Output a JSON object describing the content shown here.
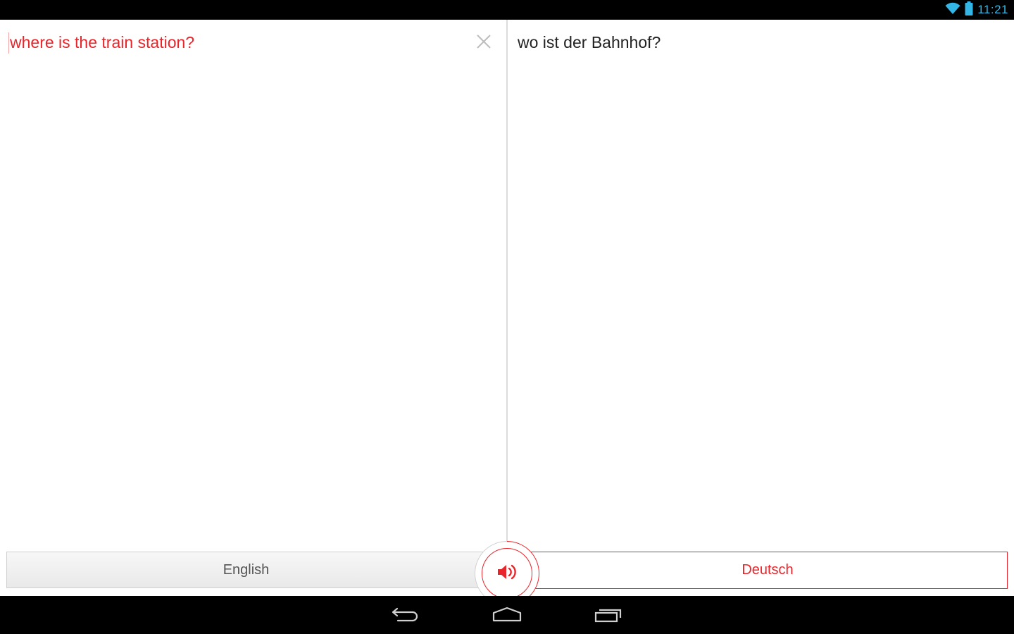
{
  "status_bar": {
    "time": "11:21",
    "icons": [
      "wifi-icon",
      "battery-icon"
    ],
    "accent_color": "#33b5e5"
  },
  "source": {
    "text": "where is the train station?",
    "clear_icon": "close-icon",
    "color": "#e8252a"
  },
  "target": {
    "text": "wo ist der Bahnhof?"
  },
  "languages": {
    "source_label": "English",
    "target_label": "Deutsch",
    "speak_icon": "speaker-icon"
  },
  "nav_bar": {
    "icons": [
      "back-icon",
      "home-icon",
      "recents-icon"
    ]
  }
}
